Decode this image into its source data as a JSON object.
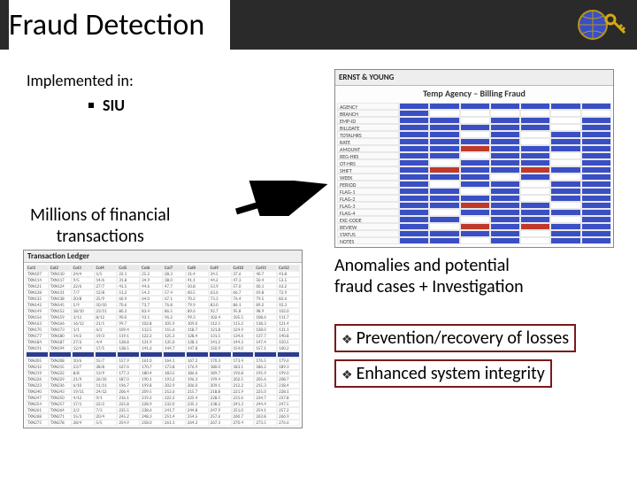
{
  "title": "Fraud Detection",
  "implemented_label": "Implemented in:",
  "bullets": [
    "SIU"
  ],
  "millions_label_line1": "Millions of financial",
  "millions_label_line2": "transactions",
  "anomalies_label_line1": "Anomalies and potential",
  "anomalies_label_line2": "fraud cases + Investigation",
  "benefits": [
    "Prevention/recovery of losses",
    "Enhanced system integrity"
  ],
  "thumb_top": {
    "vendor": "ERNST & YOUNG",
    "title": "Temp Agency – Billing Fraud",
    "row_labels": [
      "AGENCY",
      "BRANCH",
      "EMP-ID",
      "BILLDATE",
      "TOTALHRS",
      "RATE",
      "AMOUNT",
      "REG-HRS",
      "OT-HRS",
      "SHIFT",
      "WEEK",
      "PERIOD",
      "FLAG-1",
      "FLAG-2",
      "FLAG-3",
      "FLAG-4",
      "EXC-CODE",
      "REVIEW",
      "STATUS",
      "NOTES"
    ]
  },
  "thumb_bottom": {
    "title": "Transaction Ledger"
  }
}
